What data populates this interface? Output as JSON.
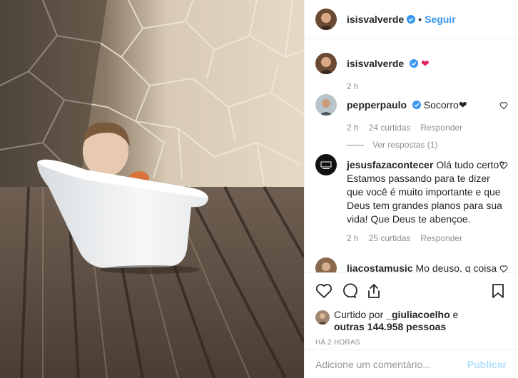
{
  "header": {
    "username": "isisvalverde",
    "dot": "•",
    "follow_label": "Seguir"
  },
  "caption": {
    "username": "isisvalverde",
    "text": "❤",
    "time": "2 h"
  },
  "comments": [
    {
      "username": "pepperpaulo",
      "verified": true,
      "text": "Socorro❤",
      "time": "2 h",
      "likes": "24 curtidas",
      "reply_label": "Responder",
      "view_replies": "Ver respostas (1)"
    },
    {
      "username": "jesusfazacontecer",
      "verified": false,
      "text": "Olá tudo certo? Estamos passando para te dizer que você é muito importante e que Deus tem grandes planos para sua vida! Que Deus te abençoe.",
      "time": "2 h",
      "likes": "25 curtidas",
      "reply_label": "Responder"
    },
    {
      "username": "liacostamusic",
      "verified": false,
      "text": "Mo deuso, q coisa"
    }
  ],
  "likes": {
    "prefix": "Curtido por ",
    "user": "_giuliacoelho",
    "middle": " e",
    "others": "outras 144.958 pessoas"
  },
  "time_ago": "HÁ 2 HORAS",
  "add_comment": {
    "placeholder": "Adicione um comentário...",
    "publish_label": "Publicar"
  },
  "colors": {
    "accent": "#3897f0",
    "publish_disabled": "#b2dffc",
    "heart": "#e0245e"
  }
}
